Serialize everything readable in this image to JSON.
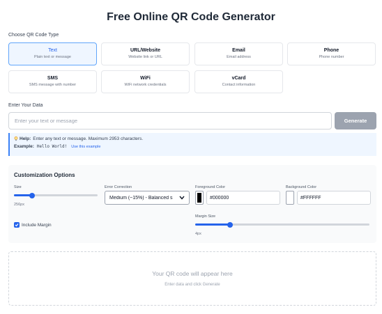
{
  "page": {
    "title": "Free Online QR Code Generator"
  },
  "type_section": {
    "label": "Choose QR Code Type",
    "types": [
      {
        "name": "Text",
        "desc": "Plain text or message",
        "active": true
      },
      {
        "name": "URL/Website",
        "desc": "Website link or URL",
        "active": false
      },
      {
        "name": "Email",
        "desc": "Email address",
        "active": false
      },
      {
        "name": "Phone",
        "desc": "Phone number",
        "active": false
      },
      {
        "name": "SMS",
        "desc": "SMS message with number",
        "active": false
      },
      {
        "name": "WiFi",
        "desc": "WiFi network credentials",
        "active": false
      },
      {
        "name": "vCard",
        "desc": "Contact information",
        "active": false
      }
    ]
  },
  "data_section": {
    "label": "Enter Your Data",
    "input_value": "",
    "input_placeholder": "Enter your text or message",
    "generate_label": "Generate"
  },
  "help": {
    "help_label": "Help:",
    "help_text": "Enter any text or message. Maximum 2953 characters.",
    "example_label": "Example:",
    "example_value": "Hello World!",
    "use_example_label": "Use this example"
  },
  "customization": {
    "title": "Customization Options",
    "size_label": "Size",
    "size_value": "256px",
    "size_fraction": 0.22,
    "error_label": "Error Correction",
    "error_selected": "Medium (~15%) - Balanced s",
    "fg_label": "Foreground Color",
    "fg_value": "#000000",
    "bg_label": "Background Color",
    "bg_value": "#FFFFFF",
    "include_margin_label": "Include Margin",
    "include_margin_checked": true,
    "margin_label": "Margin Size",
    "margin_value": "4px",
    "margin_fraction": 0.2
  },
  "preview": {
    "placeholder_title": "Your QR code will appear here",
    "placeholder_sub": "Enter data and click Generate"
  },
  "colors": {
    "accent": "#2563eb",
    "active_bg": "#eff6ff",
    "generate_disabled": "#9ca3af",
    "icons": {
      "help": "lightbulb-icon",
      "select": "chevron-down-icon",
      "checkbox": "check-icon"
    }
  }
}
